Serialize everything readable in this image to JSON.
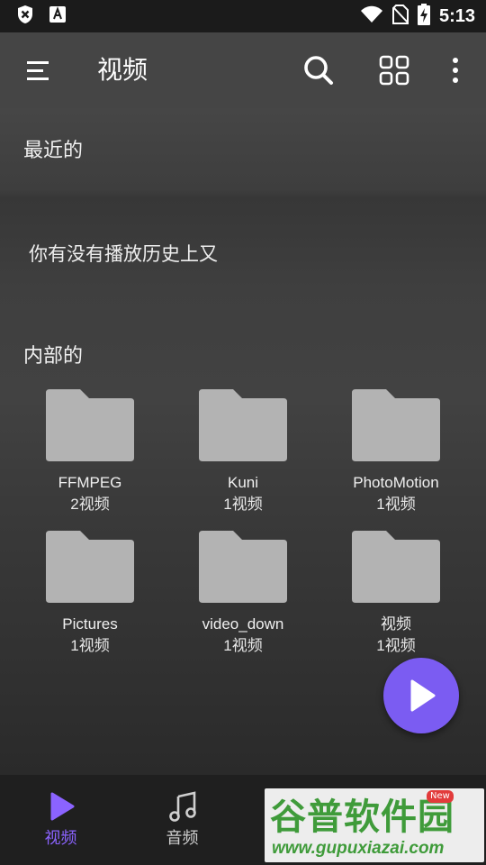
{
  "status_bar": {
    "time": "5:13"
  },
  "app_bar": {
    "title": "视频"
  },
  "sections": {
    "recent_title": "最近的",
    "empty_message": "你有没有播放历史上又",
    "internal_title": "内部的"
  },
  "folders": [
    {
      "name": "FFMPEG",
      "count": "2视频"
    },
    {
      "name": "Kuni",
      "count": "1视频"
    },
    {
      "name": "PhotoMotion",
      "count": "1视频"
    },
    {
      "name": "Pictures",
      "count": "1视频"
    },
    {
      "name": "video_down",
      "count": "1视频"
    },
    {
      "name": "视频",
      "count": "1视频"
    }
  ],
  "bottom_nav": [
    {
      "label": "视频",
      "icon": "play-icon",
      "active": true
    },
    {
      "label": "音频",
      "icon": "music-note-icon",
      "active": false
    }
  ],
  "watermark": {
    "title": "谷普软件园",
    "url": "www.gupuxiazai.com",
    "badge": "New"
  },
  "colors": {
    "accent": "#7b5cf2",
    "nav_active": "#8b63ff",
    "folder": "#b3b3b3",
    "watermark_green": "#3f9b3a"
  }
}
